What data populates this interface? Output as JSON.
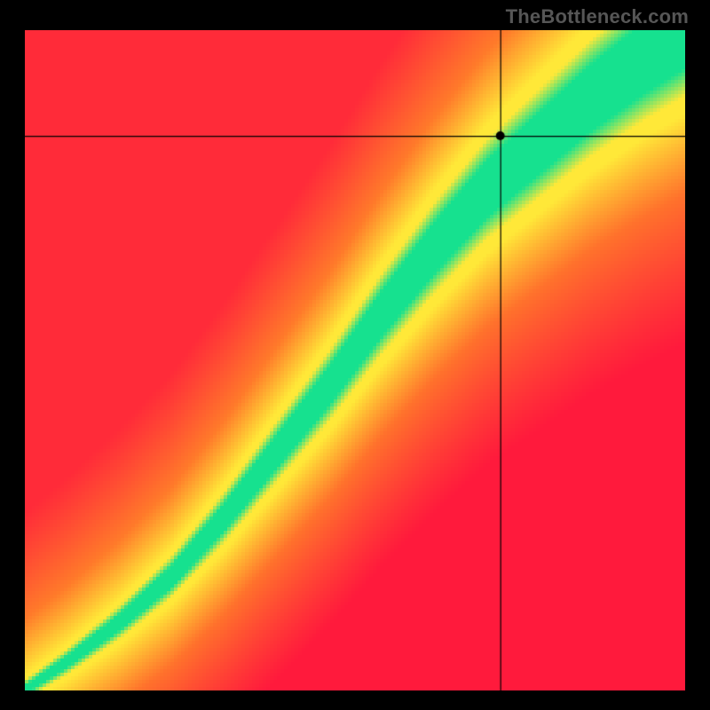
{
  "watermark": "TheBottleneck.com",
  "chart_data": {
    "type": "heatmap",
    "title": "",
    "xlabel": "",
    "ylabel": "",
    "xlim": [
      0,
      100
    ],
    "ylim": [
      0,
      100
    ],
    "grid": false,
    "legend": false,
    "green_ridge_points": [
      {
        "x": 0,
        "y": 0
      },
      {
        "x": 6,
        "y": 4
      },
      {
        "x": 14,
        "y": 10
      },
      {
        "x": 22,
        "y": 17
      },
      {
        "x": 30,
        "y": 26
      },
      {
        "x": 38,
        "y": 36
      },
      {
        "x": 46,
        "y": 46
      },
      {
        "x": 54,
        "y": 57
      },
      {
        "x": 62,
        "y": 67
      },
      {
        "x": 70,
        "y": 76
      },
      {
        "x": 78,
        "y": 83
      },
      {
        "x": 86,
        "y": 90
      },
      {
        "x": 94,
        "y": 96
      },
      {
        "x": 100,
        "y": 100
      }
    ],
    "crosshair": {
      "x": 72,
      "y": 84
    },
    "colors": {
      "red": "#ff1a3c",
      "orange": "#ff7a2a",
      "yellow": "#ffe838",
      "green": "#16e18f"
    }
  }
}
